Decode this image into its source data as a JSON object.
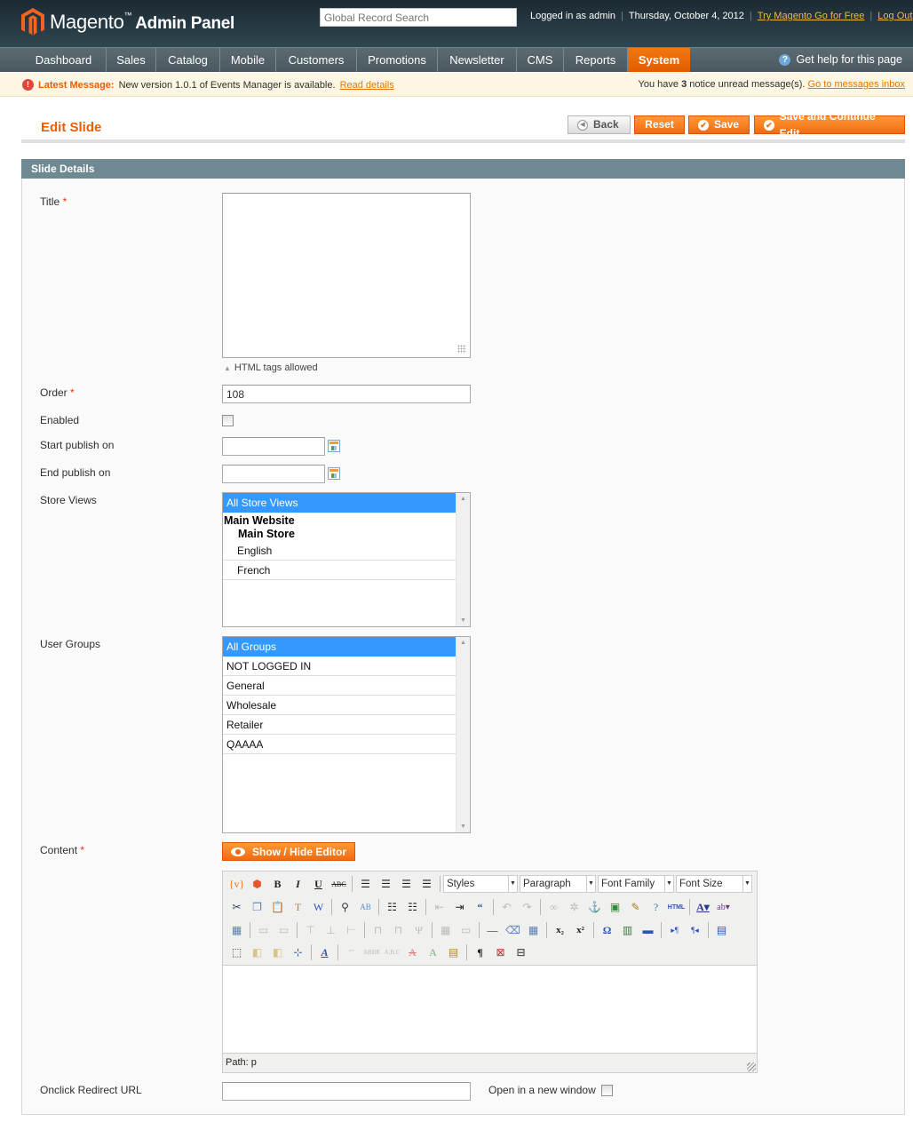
{
  "header": {
    "brand": "Magento",
    "brand_suffix": "Admin Panel",
    "search_placeholder": "Global Record Search",
    "logged_in": "Logged in as admin",
    "date": "Thursday, October 4, 2012",
    "try_link": "Try Magento Go for Free",
    "logout_link": "Log Out"
  },
  "nav": {
    "items": [
      {
        "label": "Dashboard"
      },
      {
        "label": "Sales"
      },
      {
        "label": "Catalog"
      },
      {
        "label": "Mobile"
      },
      {
        "label": "Customers"
      },
      {
        "label": "Promotions"
      },
      {
        "label": "Newsletter"
      },
      {
        "label": "CMS"
      },
      {
        "label": "Reports"
      },
      {
        "label": "System",
        "active": true
      }
    ],
    "help": "Get help for this page"
  },
  "message": {
    "title": "Latest Message:",
    "text": "New version 1.0.1 of Events Manager is available.",
    "link": "Read details",
    "notice_prefix": "You have ",
    "notice_count": "3",
    "notice_suffix": " notice unread message(s).",
    "inbox_link": "Go to messages inbox"
  },
  "page": {
    "title": "Edit Slide",
    "buttons": {
      "back": "Back",
      "reset": "Reset",
      "save": "Save",
      "save_continue": "Save and Continue Edit"
    }
  },
  "form": {
    "section_title": "Slide Details",
    "title_label": "Title",
    "title_value": "",
    "html_note": "HTML tags allowed",
    "order_label": "Order",
    "order_value": "108",
    "enabled_label": "Enabled",
    "enabled_checked": false,
    "start_label": "Start publish on",
    "start_value": "",
    "end_label": "End publish on",
    "end_value": "",
    "store_views_label": "Store Views",
    "store_views": {
      "selected": "All Store Views",
      "website": "Main Website",
      "store": "Main Store",
      "views": [
        "English",
        "French"
      ]
    },
    "user_groups_label": "User Groups",
    "user_groups": [
      "All Groups",
      "NOT LOGGED IN",
      "General",
      "Wholesale",
      "Retailer",
      "QAAAA"
    ],
    "user_groups_selected": "All Groups",
    "content_label": "Content",
    "editor_toggle": "Show / Hide Editor",
    "editor": {
      "styles": "Styles",
      "format": "Paragraph",
      "font_family": "Font Family",
      "font_size": "Font Size",
      "path": "Path: p"
    },
    "redirect_label": "Onclick Redirect URL",
    "redirect_value": "",
    "new_window_label": "Open in a new window",
    "new_window_checked": false
  }
}
